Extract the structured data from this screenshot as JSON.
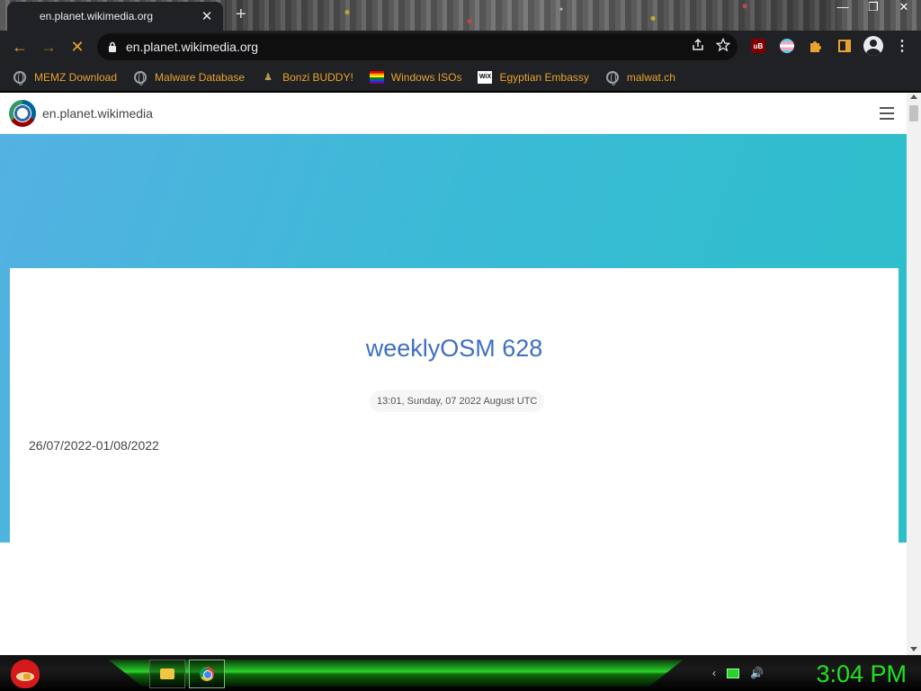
{
  "browser": {
    "tab": {
      "title": "en.planet.wikimedia.org",
      "close_glyph": "✕"
    },
    "new_tab_glyph": "+",
    "window_controls": [
      "—",
      "❐",
      "✕"
    ],
    "nav": {
      "back": "←",
      "forward": "→",
      "reload": "✕"
    },
    "omnibox": {
      "url": "en.planet.wikimedia.org",
      "lock_icon": "lock-icon"
    },
    "omnibox_actions": [
      "share-icon",
      "star-icon"
    ],
    "extensions": [
      "ublock-icon",
      "trans-flag-icon",
      "puzzle-icon",
      "side-panel-icon",
      "profile-icon",
      "menu-icon"
    ],
    "ublock_label": "uB",
    "accent_color": "#e8a230"
  },
  "bookmarks": [
    {
      "label": "MEMZ Download",
      "icon": "globe-icon"
    },
    {
      "label": "Malware Database",
      "icon": "globe-icon"
    },
    {
      "label": "Bonzi BUDDY!",
      "icon": "bonzi-icon"
    },
    {
      "label": "Windows ISOs",
      "icon": "rainbow-flag-icon"
    },
    {
      "label": "Egyptian Embassy",
      "icon": "wix-icon",
      "icon_text": "WiX"
    },
    {
      "label": "malwat.ch",
      "icon": "globe-icon"
    }
  ],
  "page": {
    "site_name": "en.planet.wikimedia",
    "post": {
      "title": "weeklyOSM 628",
      "date": "13:01, Sunday, 07 2022 August UTC",
      "range": "26/07/2022-01/08/2022"
    },
    "hero_colors": [
      "#54b1e2",
      "#2bbfc9"
    ]
  },
  "taskbar": {
    "clock": "3:04 PM",
    "apps": [
      "file-explorer-icon",
      "chrome-icon"
    ],
    "tray": [
      "chevron-icon",
      "network-icon",
      "volume-icon"
    ],
    "tray_glyphs": {
      "chevron": "‹",
      "volume": "🔊"
    }
  }
}
